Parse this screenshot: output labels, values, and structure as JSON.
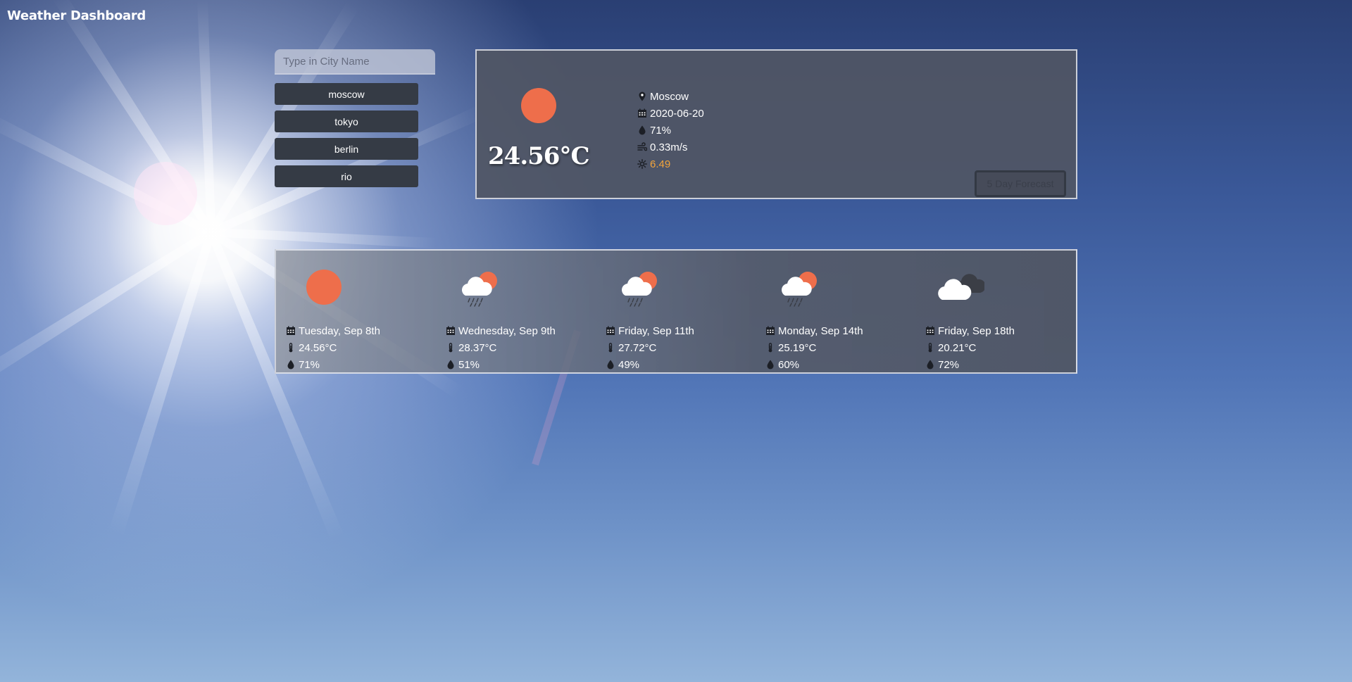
{
  "app": {
    "title": "Weather Dashboard"
  },
  "search": {
    "placeholder": "Type in City Name",
    "value": ""
  },
  "cities": [
    "moscow",
    "tokyo",
    "berlin",
    "rio"
  ],
  "current": {
    "icon": "sun-icon",
    "temperature": "24.56°C",
    "city": "Moscow",
    "date": "2020-06-20",
    "humidity": "71%",
    "wind": "0.33m/s",
    "uv_index": "6.49",
    "uv_color": "#f2a43c",
    "forecast_button": "5 Day Forecast"
  },
  "forecast": [
    {
      "icon": "sun-icon",
      "date": "Tuesday, Sep 8th",
      "temp": "24.56°C",
      "humidity": "71%"
    },
    {
      "icon": "rain-sun-icon",
      "date": "Wednesday, Sep 9th",
      "temp": "28.37°C",
      "humidity": "51%"
    },
    {
      "icon": "rain-sun-icon",
      "date": "Friday, Sep 11th",
      "temp": "27.72°C",
      "humidity": "49%"
    },
    {
      "icon": "rain-sun-icon",
      "date": "Monday, Sep 14th",
      "temp": "25.19°C",
      "humidity": "60%"
    },
    {
      "icon": "cloudy-icon",
      "date": "Friday, Sep 18th",
      "temp": "20.21°C",
      "humidity": "72%"
    }
  ],
  "colors": {
    "sun": "#ee6e4b",
    "button_bg": "#353b45",
    "card_bg": "#50566a"
  }
}
